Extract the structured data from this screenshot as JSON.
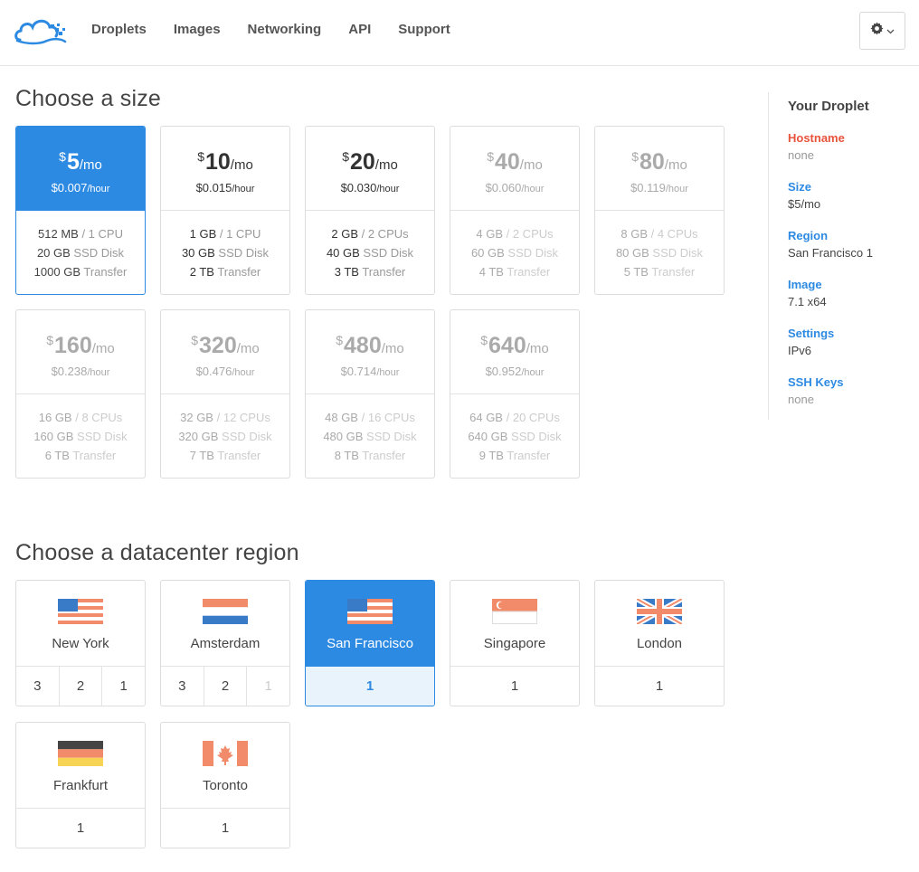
{
  "colors": {
    "accent": "#2d8ae2",
    "warning": "#e8533c",
    "flag_blue": "#3a7bc8",
    "flag_orange": "#f28b6a"
  },
  "header": {
    "logo_icon": "cloud-logo-icon",
    "nav": [
      "Droplets",
      "Images",
      "Networking",
      "API",
      "Support"
    ],
    "settings_icon": "gear-icon"
  },
  "size_section": {
    "title": "Choose a size",
    "sizes": [
      {
        "currency": "$",
        "amount": "5",
        "per": "/mo",
        "hourly": "$0.007",
        "hourly_unit": "/hour",
        "mem": "512 MB",
        "cpu": "/ 1 CPU",
        "disk": "20 GB",
        "disk_label": "SSD Disk",
        "transfer": "1000 GB",
        "transfer_label": "Transfer",
        "state": "selected"
      },
      {
        "currency": "$",
        "amount": "10",
        "per": "/mo",
        "hourly": "$0.015",
        "hourly_unit": "/hour",
        "mem": "1 GB",
        "cpu": "/ 1 CPU",
        "disk": "30 GB",
        "disk_label": "SSD Disk",
        "transfer": "2 TB",
        "transfer_label": "Transfer",
        "state": "enabled"
      },
      {
        "currency": "$",
        "amount": "20",
        "per": "/mo",
        "hourly": "$0.030",
        "hourly_unit": "/hour",
        "mem": "2 GB",
        "cpu": "/ 2 CPUs",
        "disk": "40 GB",
        "disk_label": "SSD Disk",
        "transfer": "3 TB",
        "transfer_label": "Transfer",
        "state": "enabled"
      },
      {
        "currency": "$",
        "amount": "40",
        "per": "/mo",
        "hourly": "$0.060",
        "hourly_unit": "/hour",
        "mem": "4 GB",
        "cpu": "/ 2 CPUs",
        "disk": "60 GB",
        "disk_label": "SSD Disk",
        "transfer": "4 TB",
        "transfer_label": "Transfer",
        "state": "disabled"
      },
      {
        "currency": "$",
        "amount": "80",
        "per": "/mo",
        "hourly": "$0.119",
        "hourly_unit": "/hour",
        "mem": "8 GB",
        "cpu": "/ 4 CPUs",
        "disk": "80 GB",
        "disk_label": "SSD Disk",
        "transfer": "5 TB",
        "transfer_label": "Transfer",
        "state": "disabled"
      },
      {
        "currency": "$",
        "amount": "160",
        "per": "/mo",
        "hourly": "$0.238",
        "hourly_unit": "/hour",
        "mem": "16 GB",
        "cpu": "/ 8 CPUs",
        "disk": "160 GB",
        "disk_label": "SSD Disk",
        "transfer": "6 TB",
        "transfer_label": "Transfer",
        "state": "disabled"
      },
      {
        "currency": "$",
        "amount": "320",
        "per": "/mo",
        "hourly": "$0.476",
        "hourly_unit": "/hour",
        "mem": "32 GB",
        "cpu": "/ 12 CPUs",
        "disk": "320 GB",
        "disk_label": "SSD Disk",
        "transfer": "7 TB",
        "transfer_label": "Transfer",
        "state": "disabled"
      },
      {
        "currency": "$",
        "amount": "480",
        "per": "/mo",
        "hourly": "$0.714",
        "hourly_unit": "/hour",
        "mem": "48 GB",
        "cpu": "/ 16 CPUs",
        "disk": "480 GB",
        "disk_label": "SSD Disk",
        "transfer": "8 TB",
        "transfer_label": "Transfer",
        "state": "disabled"
      },
      {
        "currency": "$",
        "amount": "640",
        "per": "/mo",
        "hourly": "$0.952",
        "hourly_unit": "/hour",
        "mem": "64 GB",
        "cpu": "/ 20 CPUs",
        "disk": "640 GB",
        "disk_label": "SSD Disk",
        "transfer": "9 TB",
        "transfer_label": "Transfer",
        "state": "disabled"
      }
    ]
  },
  "sidebar": {
    "title": "Your Droplet",
    "rows": [
      {
        "key": "Hostname",
        "value": "none"
      },
      {
        "key": "Size",
        "value": "$5/mo"
      },
      {
        "key": "Region",
        "value": "San Francisco 1"
      },
      {
        "key": "Image",
        "value": "7.1 x64"
      },
      {
        "key": "Settings",
        "value": "IPv6"
      },
      {
        "key": "SSH Keys",
        "value": "none"
      }
    ]
  },
  "region_section": {
    "title": "Choose a datacenter region",
    "regions": [
      {
        "name": "New York",
        "flag": "us-flag-icon",
        "numbers": [
          {
            "n": "3",
            "on": true
          },
          {
            "n": "2",
            "on": true
          },
          {
            "n": "1",
            "on": true
          }
        ],
        "state": "normal"
      },
      {
        "name": "Amsterdam",
        "flag": "nl-flag-icon",
        "numbers": [
          {
            "n": "3",
            "on": true
          },
          {
            "n": "2",
            "on": true
          },
          {
            "n": "1",
            "on": false
          }
        ],
        "state": "normal"
      },
      {
        "name": "San Francisco",
        "flag": "us-flag-icon",
        "numbers": [
          {
            "n": "1",
            "on": true
          }
        ],
        "state": "selected"
      },
      {
        "name": "Singapore",
        "flag": "sg-flag-icon",
        "numbers": [
          {
            "n": "1",
            "on": true
          }
        ],
        "state": "normal"
      },
      {
        "name": "London",
        "flag": "uk-flag-icon",
        "numbers": [
          {
            "n": "1",
            "on": true
          }
        ],
        "state": "normal"
      },
      {
        "name": "Frankfurt",
        "flag": "de-flag-icon",
        "numbers": [
          {
            "n": "1",
            "on": true
          }
        ],
        "state": "normal"
      },
      {
        "name": "Toronto",
        "flag": "ca-flag-icon",
        "numbers": [
          {
            "n": "1",
            "on": true
          }
        ],
        "state": "normal"
      }
    ]
  }
}
